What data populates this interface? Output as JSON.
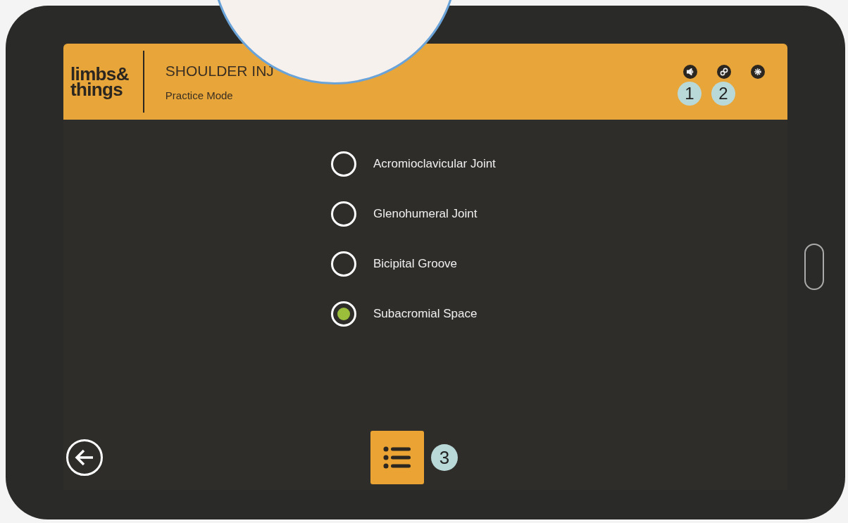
{
  "header": {
    "logo_line1": "limbs&",
    "logo_line2": "things",
    "title": "SHOULDER INJ",
    "subtitle": "Practice Mode"
  },
  "callouts": [
    "1",
    "2",
    "3"
  ],
  "options": [
    {
      "label": "Acromioclavicular Joint",
      "selected": false
    },
    {
      "label": "Glenohumeral Joint",
      "selected": false
    },
    {
      "label": "Bicipital Groove",
      "selected": false
    },
    {
      "label": "Subacromial Space",
      "selected": true
    }
  ]
}
